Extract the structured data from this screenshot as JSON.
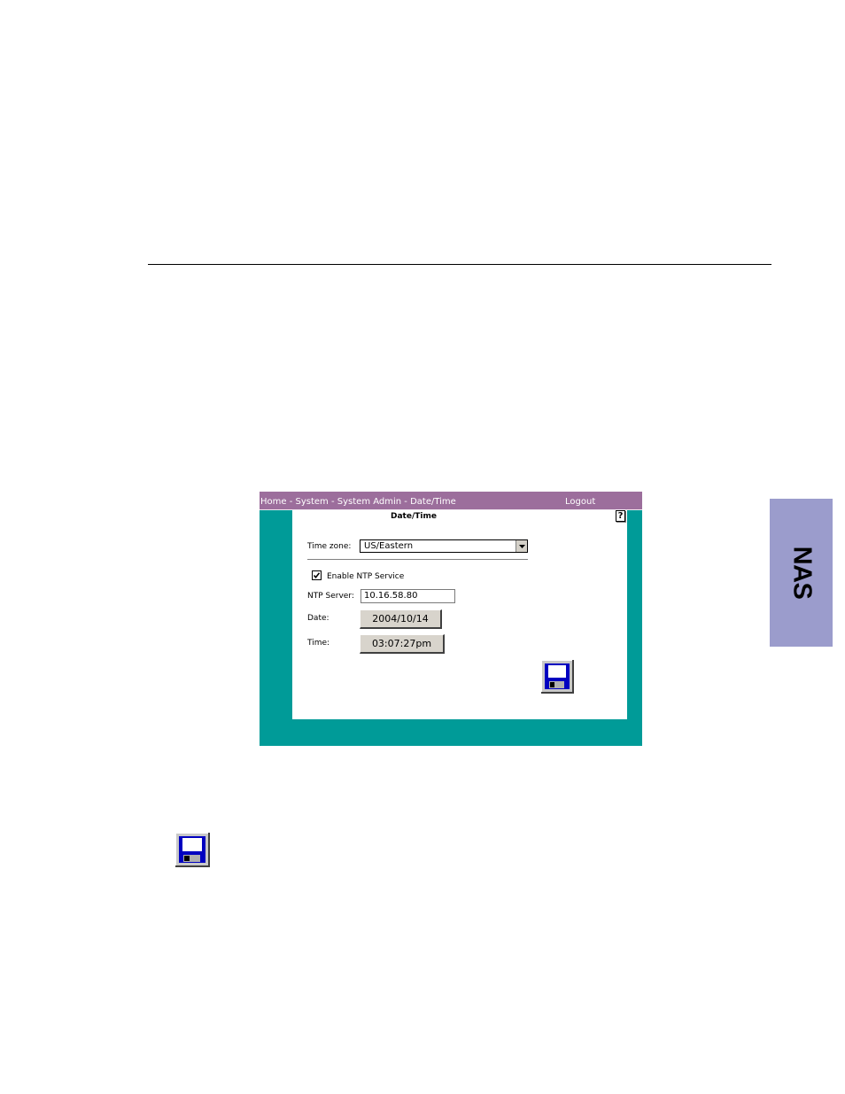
{
  "page": {
    "side_tab": "NAS"
  },
  "screenshot": {
    "breadcrumb": [
      "Home",
      "System",
      "System Admin",
      "Date/Time"
    ],
    "breadcrumb_separator": " - ",
    "logout_label": "Logout",
    "panel_title": "Date/Time",
    "help_label": "?",
    "time_zone_label": "Time zone:",
    "time_zone_value": "US/Eastern",
    "enable_ntp_label": "Enable NTP Service",
    "enable_ntp_checked": true,
    "ntp_server_label": "NTP Server:",
    "ntp_server_value": "10.16.58.80",
    "date_label": "Date:",
    "date_value": "2004/10/14",
    "time_label": "Time:",
    "time_value": "03:07:27pm",
    "colors": {
      "frame": "#009b98",
      "topbar": "#9c6e9c",
      "side_tab": "#9b9ccc",
      "save_icon": "#0000c0"
    }
  },
  "icons": {
    "save": "floppy-disk-icon",
    "dropdown": "chevron-down-icon",
    "checkbox": "checkmark-icon"
  }
}
